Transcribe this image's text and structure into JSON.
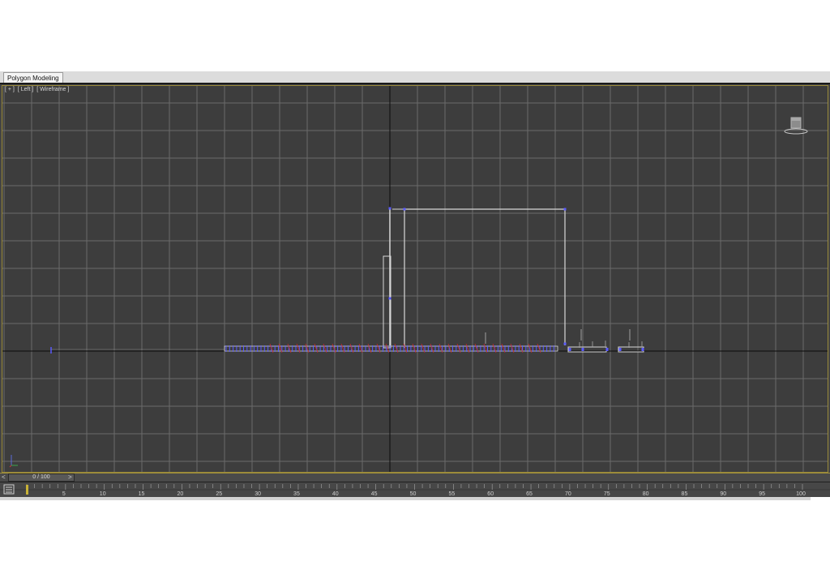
{
  "ribbon": {
    "tab_label": "Polygon Modeling"
  },
  "viewport": {
    "labels": [
      "[ + ]",
      "[ Left ]",
      "[ Wireframe ]"
    ],
    "background": "#3d3d3d",
    "grid_color": "#6a6a6a",
    "axis_color": "#0a0a0a",
    "wire_color": "#d8d8d8",
    "vertex_color": "#5b5bff",
    "spline_color": "#cc2a2a",
    "border_color": "#9a8a3a"
  },
  "viewcube": {
    "icon": "viewcube-icon"
  },
  "axis_tripod": {
    "icon": "axis-tripod-icon"
  },
  "time_slider": {
    "prev": "<",
    "position": "0 / 100",
    "next": ">"
  },
  "trackbar": {
    "icon": "trackbar-toggle-icon",
    "marker_color": "#c8b236",
    "start": 0,
    "end": 100,
    "labels": [
      "5",
      "10",
      "15",
      "20",
      "25",
      "30",
      "35",
      "40",
      "45",
      "50",
      "55",
      "60",
      "65",
      "70",
      "75",
      "80",
      "85",
      "90",
      "95",
      "100"
    ]
  }
}
